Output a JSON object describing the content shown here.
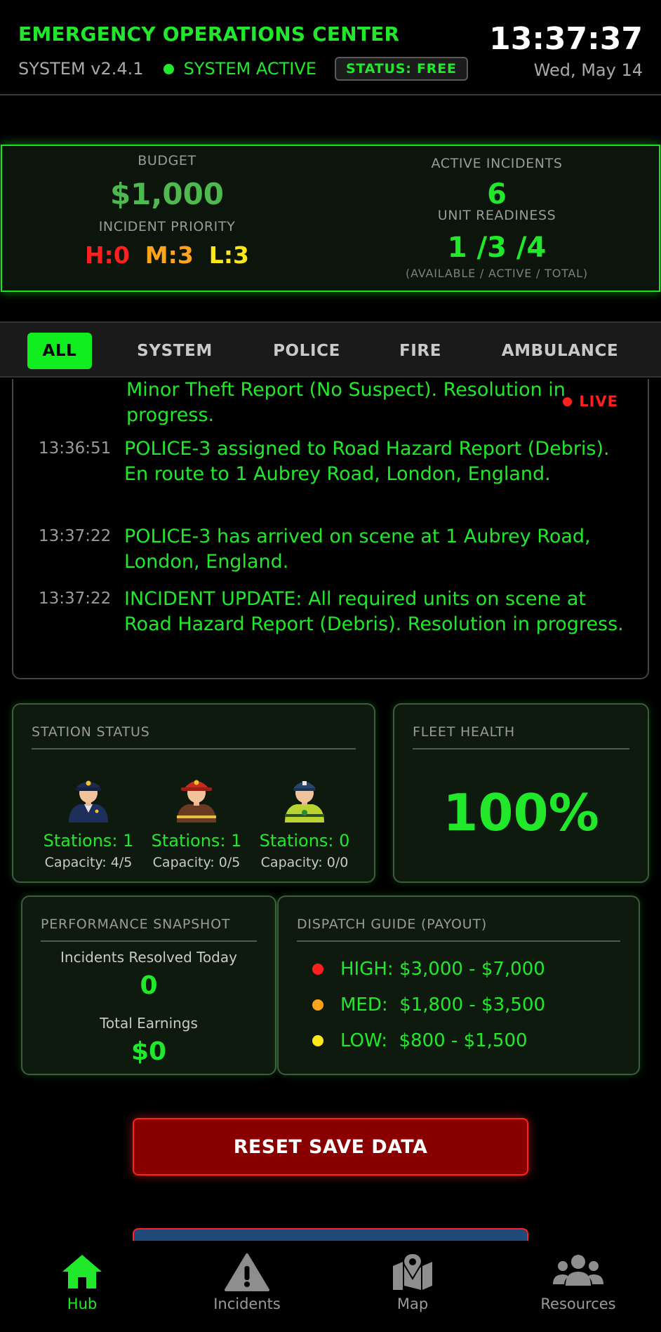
{
  "header": {
    "title": "EMERGENCY OPERATIONS CENTER",
    "version": "SYSTEM v2.4.1",
    "system_status": "SYSTEM ACTIVE",
    "status_badge": "STATUS: FREE",
    "time": "13:37:37",
    "date": "Wed, May 14"
  },
  "stats": {
    "budget_label": "BUDGET",
    "budget_value": "$1,000",
    "priority_label": "INCIDENT PRIORITY",
    "priority_high": "H:0",
    "priority_med": "M:3",
    "priority_low": "L:3",
    "active_incidents_label": "ACTIVE INCIDENTS",
    "active_incidents_value": "6",
    "unit_readiness_label": "UNIT READINESS",
    "unit_readiness_value": "1 /3 /4",
    "unit_readiness_caption": "(AVAILABLE / ACTIVE / TOTAL)"
  },
  "tabs": [
    {
      "label": "ALL",
      "active": true
    },
    {
      "label": "SYSTEM",
      "active": false
    },
    {
      "label": "POLICE",
      "active": false
    },
    {
      "label": "FIRE",
      "active": false
    },
    {
      "label": "AMBULANCE",
      "active": false
    }
  ],
  "log": {
    "live_label": "LIVE",
    "entries": [
      {
        "time": "",
        "text": "Minor Theft Report (No Suspect). Resolution in progress."
      },
      {
        "time": "13:36:51",
        "text": "POLICE-3 assigned to Road Hazard Report (Debris). En route to 1 Aubrey Road, London, England."
      },
      {
        "time": "13:37:22",
        "text": "POLICE-3 has arrived on scene at 1 Aubrey Road, London, England."
      },
      {
        "time": "13:37:22",
        "text": "INCIDENT UPDATE: All required units on scene at Road Hazard Report (Debris). Resolution in progress."
      }
    ]
  },
  "station_status": {
    "title": "STATION STATUS",
    "stations": [
      {
        "icon": "police-officer-icon",
        "count": "Stations: 1",
        "capacity": "Capacity: 4/5"
      },
      {
        "icon": "firefighter-icon",
        "count": "Stations: 1",
        "capacity": "Capacity: 0/5"
      },
      {
        "icon": "paramedic-icon",
        "count": "Stations: 0",
        "capacity": "Capacity: 0/0"
      }
    ]
  },
  "fleet_health": {
    "title": "FLEET HEALTH",
    "value": "100%"
  },
  "performance": {
    "title": "PERFORMANCE SNAPSHOT",
    "resolved_label": "Incidents Resolved Today",
    "resolved_value": "0",
    "earnings_label": "Total Earnings",
    "earnings_value": "$0"
  },
  "dispatch_guide": {
    "title": "DISPATCH GUIDE (PAYOUT)",
    "rows": [
      {
        "text": "HIGH: $3,000 - $7,000",
        "color": "#ff1f1f"
      },
      {
        "text": "MED:  $1,800 - $3,500",
        "color": "#ffa31a"
      },
      {
        "text": "LOW:  $800 - $1,500",
        "color": "#ffe81a"
      }
    ]
  },
  "actions": {
    "reset_label": "RESET SAVE DATA"
  },
  "nav": [
    {
      "label": "Hub",
      "icon": "home-icon",
      "active": true
    },
    {
      "label": "Incidents",
      "icon": "warning-icon",
      "active": false
    },
    {
      "label": "Map",
      "icon": "map-icon",
      "active": false
    },
    {
      "label": "Resources",
      "icon": "people-icon",
      "active": false
    }
  ],
  "colors": {
    "accent": "#22e82b",
    "alert": "#ff1f1f",
    "background": "#000000"
  }
}
